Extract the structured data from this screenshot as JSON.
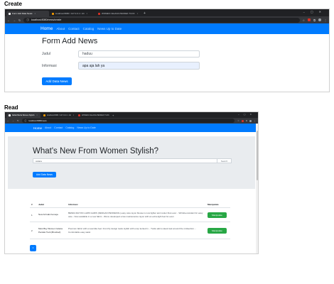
{
  "labels": {
    "create": "Create",
    "read": "Read"
  },
  "create": {
    "tabs": [
      {
        "title": "Form Add Data News",
        "active": true,
        "color": "#ffffff"
      },
      {
        "title": "localhost:8080 / 127.0.0.1 / citi",
        "active": false,
        "color": "#f29900"
      },
      {
        "title": "WOMEN CELANA PENDEK TUCK",
        "active": false,
        "color": "#d93025"
      }
    ],
    "url": "localhost:8080/news/create",
    "nav": {
      "brand": "Home",
      "links": [
        "About",
        "Contact",
        "Catalog",
        "News Up to Date"
      ]
    },
    "form": {
      "heading": "Form Add News",
      "judul_label": "Judul",
      "judul_value": "haduu",
      "informasi_label": "Informasi",
      "informasi_value": "apa aja lah ya",
      "submit_label": "Add Data News"
    }
  },
  "read": {
    "tabs": [
      {
        "title": "Daftar Berita Women Stylish",
        "active": true,
        "color": "#ffffff"
      },
      {
        "title": "localhost:8080 / 127.0.0.1 / citi",
        "active": false,
        "color": "#f29900"
      },
      {
        "title": "WOMEN CELANA PENDEK TUCK",
        "active": false,
        "color": "#d93025"
      }
    ],
    "url": "localhost:8080/news",
    "nav": {
      "brand": "Home",
      "links": [
        "About",
        "Contact",
        "Catalog",
        "News Up to Date"
      ]
    },
    "jumbotron": {
      "heading": "What's New From Women Stylish?",
      "search_value": "celana",
      "search_button": "Search",
      "add_button": "Add Data News"
    },
    "table": {
      "headers": [
        "#",
        "Judul",
        "Informasi",
        "Manipulate"
      ],
      "rows": [
        {
          "no": "1",
          "judul": "New Arrivals Kemeja",
          "informasi": "BENDA RAYON LAWN GARIS (DENGAN PENDEKOL) easy care rayon blouse is now lighter and cooler than ever. - Wrinkle-resistant for easy care - Now available in a new fabric - We've developed a low maintenance rayon with an extra-light feel for even",
          "button": "Manipulate"
        },
        {
          "no": "2",
          "judul": "Most Buy Women Celana Pendek Tuck (Brushed)",
          "informasi": "Premium fabric with a wool-like feel. Front fly design looks stylish with a top tucked in. - Tucks add a sleek look around the midsection. - Comfortable easy waist",
          "button": "Manipulate"
        }
      ]
    },
    "pagination": {
      "current": "1"
    }
  },
  "colors": {
    "primary": "#007bff",
    "success": "#28a745",
    "jumbotron": "#e9ecef",
    "chrome_dark": "#202124",
    "chrome_mid": "#35363a"
  }
}
